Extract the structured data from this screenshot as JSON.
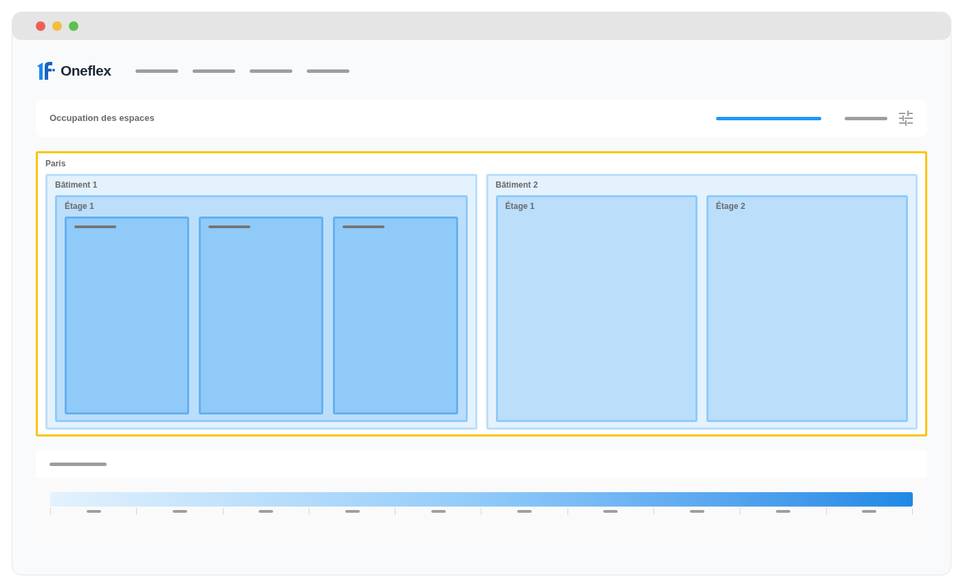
{
  "brand": {
    "name": "Oneflex"
  },
  "header": {
    "title": "Occupation des espaces",
    "tabs": [
      {
        "selected": true
      },
      {
        "selected": false
      }
    ]
  },
  "site": {
    "name": "Paris",
    "buildings": [
      {
        "name": "Bâtiment 1",
        "floors": [
          {
            "name": "Étage 1",
            "rooms": [
              {
                "kind": "room"
              },
              {
                "kind": "room"
              },
              {
                "kind": "room"
              }
            ]
          }
        ]
      },
      {
        "name": "Bâtiment 2",
        "floors": [
          {
            "name": "Étage 1"
          },
          {
            "name": "Étage 2"
          }
        ]
      }
    ]
  }
}
